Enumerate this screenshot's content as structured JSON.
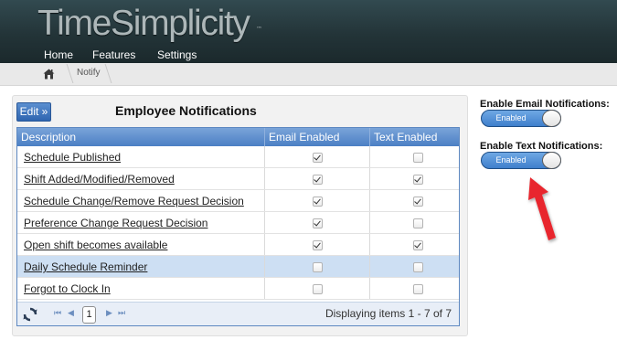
{
  "app": {
    "logo": "TimeSimplicity",
    "logo_mark": "™"
  },
  "nav": {
    "items": [
      {
        "label": "Home"
      },
      {
        "label": "Features"
      },
      {
        "label": "Settings"
      }
    ]
  },
  "breadcrumb": {
    "home_icon": "home-icon",
    "current": "Notify"
  },
  "panel": {
    "edit_label": "Edit »",
    "title": "Employee Notifications",
    "columns": [
      "Description",
      "Email Enabled",
      "Text Enabled"
    ],
    "rows": [
      {
        "description": "Schedule Published",
        "email": true,
        "text": false
      },
      {
        "description": "Shift Added/Modified/Removed",
        "email": true,
        "text": true
      },
      {
        "description": "Schedule Change/Remove Request Decision",
        "email": true,
        "text": true
      },
      {
        "description": "Preference Change Request Decision",
        "email": true,
        "text": false
      },
      {
        "description": "Open shift becomes available",
        "email": true,
        "text": true
      },
      {
        "description": "Daily Schedule Reminder",
        "email": false,
        "text": false,
        "selected": true
      },
      {
        "description": "Forgot to Clock In",
        "email": false,
        "text": false
      }
    ],
    "pager": {
      "current_page": "1",
      "info": "Displaying items 1 - 7 of 7",
      "icons": [
        "refresh-icon",
        "first-page-icon",
        "prev-page-icon",
        "next-page-icon",
        "last-page-icon"
      ]
    }
  },
  "settings": {
    "email_label": "Enable Email Notifications:",
    "email_toggle": "Enabled",
    "text_label": "Enable Text Notifications:",
    "text_toggle": "Enabled"
  },
  "colors": {
    "header_bg": "#233438",
    "grid_header": "#4b7fc4",
    "toggle": "#3f7fcc",
    "annotation_arrow": "#e8262d",
    "selected_row": "#cddff3"
  }
}
